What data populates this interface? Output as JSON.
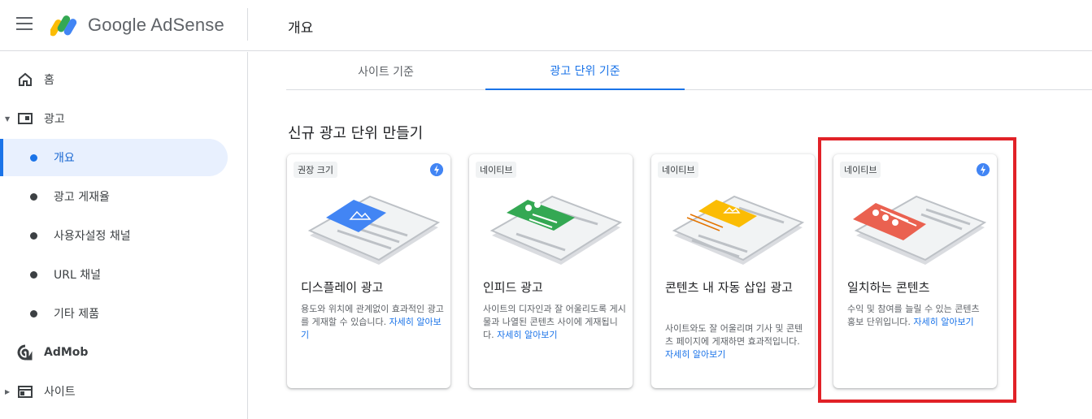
{
  "header": {
    "brand": "Google AdSense",
    "page_title": "개요"
  },
  "sidebar": {
    "items": [
      {
        "label": "홈"
      },
      {
        "label": "광고"
      },
      {
        "label": "개요"
      },
      {
        "label": "광고 게재율"
      },
      {
        "label": "사용자설정 채널"
      },
      {
        "label": "URL 채널"
      },
      {
        "label": "기타 제품"
      },
      {
        "label": "AdMob"
      },
      {
        "label": "사이트"
      }
    ]
  },
  "tabs": [
    {
      "label": "사이트 기준"
    },
    {
      "label": "광고 단위 기준"
    }
  ],
  "section_title": "신규 광고 단위 만들기",
  "cards": [
    {
      "badge": "권장 크기",
      "title": "디스플레이 광고",
      "desc": "용도와 위치에 관계없이 효과적인 광고를 게재할 수 있습니다. ",
      "link": "자세히 알아보기",
      "accent": "#4285f4"
    },
    {
      "badge": "네이티브",
      "title": "인피드 광고",
      "desc": "사이트의 디자인과 잘 어울리도록 게시물과 나열된 콘텐츠 사이에 게재됩니다. ",
      "link": "자세히 알아보기",
      "accent": "#34a853"
    },
    {
      "badge": "네이티브",
      "title": "콘텐츠 내 자동 삽입 광고",
      "desc": "사이트와도 잘 어울리며 기사 및 콘텐츠 페이지에 게재하면 효과적입니다. ",
      "link": "자세히 알아보기",
      "accent": "#fbbc04"
    },
    {
      "badge": "네이티브",
      "title": "일치하는 콘텐츠",
      "desc": "수익 및 참여를 늘릴 수 있는 콘텐츠 홍보 단위입니다. ",
      "link": "자세히 알아보기",
      "accent": "#ea6150"
    }
  ]
}
